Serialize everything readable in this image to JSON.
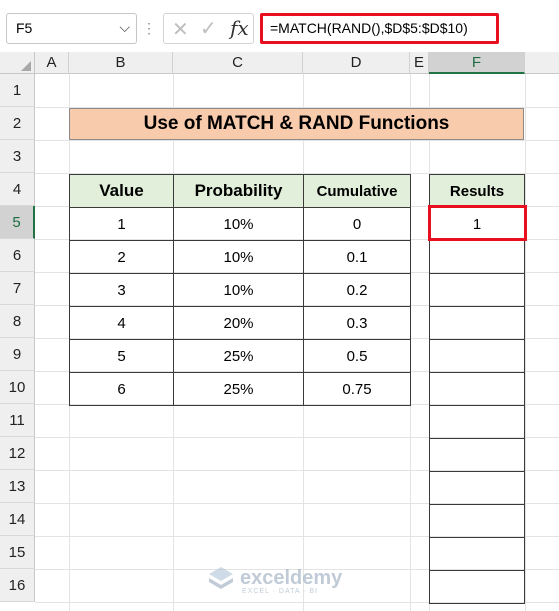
{
  "name_box": "F5",
  "formula": "=MATCH(RAND(),$D$5:$D$10)",
  "fx_label": "fx",
  "columns": [
    "A",
    "B",
    "C",
    "D",
    "E",
    "F"
  ],
  "selected_column": "F",
  "rows": [
    "1",
    "2",
    "3",
    "4",
    "5",
    "6",
    "7",
    "8",
    "9",
    "10",
    "11",
    "12",
    "13",
    "14",
    "15",
    "16"
  ],
  "selected_row": "5",
  "title": "Use of MATCH & RAND Functions",
  "table": {
    "headers": [
      "Value",
      "Probability",
      "Cumulative"
    ],
    "rows": [
      [
        "1",
        "10%",
        "0"
      ],
      [
        "2",
        "10%",
        "0.1"
      ],
      [
        "3",
        "10%",
        "0.2"
      ],
      [
        "4",
        "20%",
        "0.3"
      ],
      [
        "5",
        "25%",
        "0.5"
      ],
      [
        "6",
        "25%",
        "0.75"
      ]
    ]
  },
  "results": {
    "header": "Results",
    "values": [
      "1",
      "",
      "",
      "",
      "",
      "",
      "",
      "",
      "",
      "",
      "",
      ""
    ]
  },
  "watermark": {
    "name": "exceldemy",
    "tagline": "EXCEL · DATA · BI"
  },
  "colors": {
    "title_fill": "#f8cbad",
    "header_fill": "#e2efda",
    "highlight_border": "#e8101e",
    "selection_green": "#217346"
  }
}
